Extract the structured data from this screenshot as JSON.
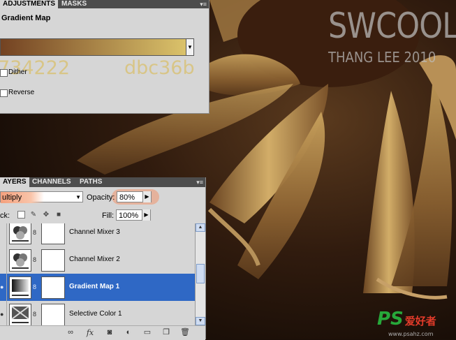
{
  "watermark": {
    "title": "SWCOOL",
    "subtitle": "THANG LEE 2010"
  },
  "adjustments": {
    "tabs": [
      "ADJUSTMENTS",
      "MASKS"
    ],
    "title": "Gradient Map",
    "gradient": {
      "start": "#734222",
      "end": "#dbc36b"
    },
    "hex_left": "734222",
    "hex_right": "dbc36b",
    "dither_label": "Dither",
    "reverse_label": "Reverse"
  },
  "layers_panel": {
    "tabs": [
      "AYERS",
      "CHANNELS",
      "PATHS"
    ],
    "blend_mode": "ultiply",
    "opacity_label": "Opacity:",
    "opacity_value": "80%",
    "lock_label": "ck:",
    "fill_label": "Fill:",
    "fill_value": "100%",
    "layers": [
      {
        "name": "Channel Mixer 3",
        "selected": false,
        "thumb": "channel-mixer"
      },
      {
        "name": "Channel Mixer 2",
        "selected": false,
        "thumb": "channel-mixer"
      },
      {
        "name": "Gradient Map 1",
        "selected": true,
        "thumb": "gradient-map"
      },
      {
        "name": "Selective Color 1",
        "selected": false,
        "thumb": "selective-color"
      }
    ],
    "bottom_icons": [
      "link-icon",
      "fx-icon",
      "mask-icon",
      "adjustment-icon",
      "folder-icon",
      "new-layer-icon",
      "trash-icon"
    ]
  },
  "site_logo": {
    "ps": "PS",
    "cn": "爱好者",
    "url": "www.psahz.com"
  },
  "colors": {
    "panel": "#d6d6d6",
    "selection": "#2f68c5",
    "highlight": "#f4a07d"
  }
}
